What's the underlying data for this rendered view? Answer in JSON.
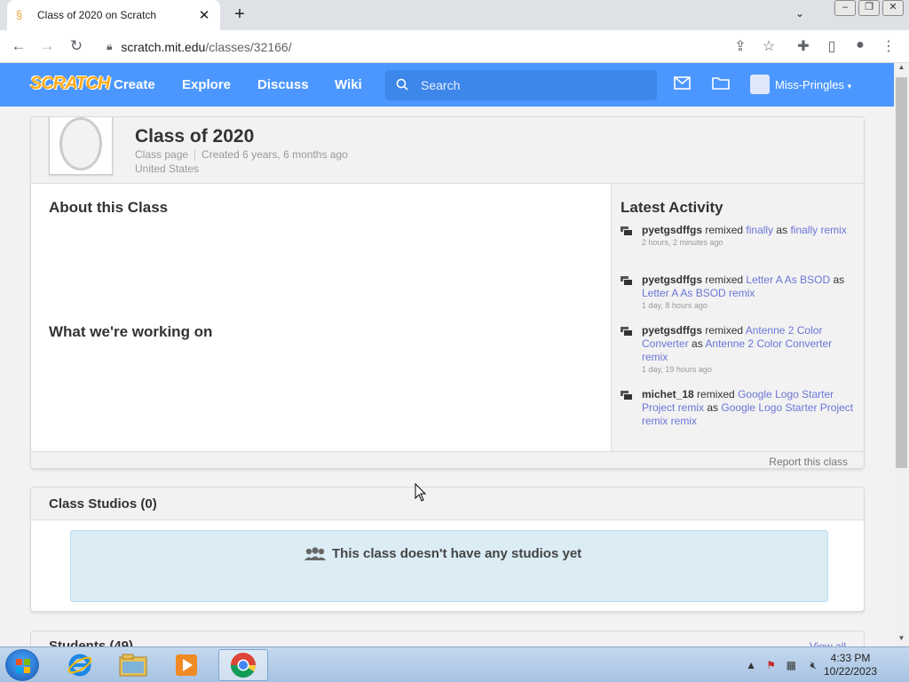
{
  "browser": {
    "tab_title": "Class of 2020 on Scratch",
    "tab_close": "✕",
    "new_tab": "+",
    "url_host": "scratch.mit.edu",
    "url_path": "/classes/32166/"
  },
  "scratch_nav": {
    "logo": "SCRATCH",
    "links": [
      "Create",
      "Explore",
      "Discuss",
      "Wiki"
    ],
    "search_placeholder": "Search",
    "username": "Miss-Pringles"
  },
  "class_info": {
    "title": "Class of 2020",
    "type": "Class page",
    "created": "Created 6 years, 6 months ago",
    "country": "United States"
  },
  "sections": {
    "about": "About this Class",
    "working_on": "What we're working on",
    "latest_activity": "Latest Activity",
    "report": "Report this class"
  },
  "activity": [
    {
      "user": "pyetgsdffgs",
      "verb": "remixed",
      "project": "finally",
      "as": "as",
      "remix": "finally remix",
      "time": "2 hours, 2 minutes ago"
    },
    {
      "user": "pyetgsdffgs",
      "verb": "remixed",
      "project": "Letter A As BSOD",
      "as": "as",
      "remix": "Letter A As BSOD remix",
      "time": "1 day, 8 hours ago"
    },
    {
      "user": "pyetgsdffgs",
      "verb": "remixed",
      "project": "Antenne 2 Color Converter",
      "as": "as",
      "remix": "Antenne 2 Color Converter remix",
      "time": "1 day, 19 hours ago"
    },
    {
      "user": "michet_18",
      "verb": "remixed",
      "project": "Google Logo Starter Project remix",
      "as": "as",
      "remix": "Google Logo Starter Project remix remix",
      "time": ""
    }
  ],
  "studios": {
    "title": "Class Studios (0)",
    "empty_message": "This class doesn't have any studios yet"
  },
  "students": {
    "title": "Students (49)",
    "view_all": "View all"
  },
  "taskbar": {
    "time": "4:33 PM",
    "date": "10/22/2023"
  },
  "colors": {
    "scratch_blue": "#4c97ff",
    "link": "#6b75d6",
    "empty_box": "#dbecf5"
  }
}
